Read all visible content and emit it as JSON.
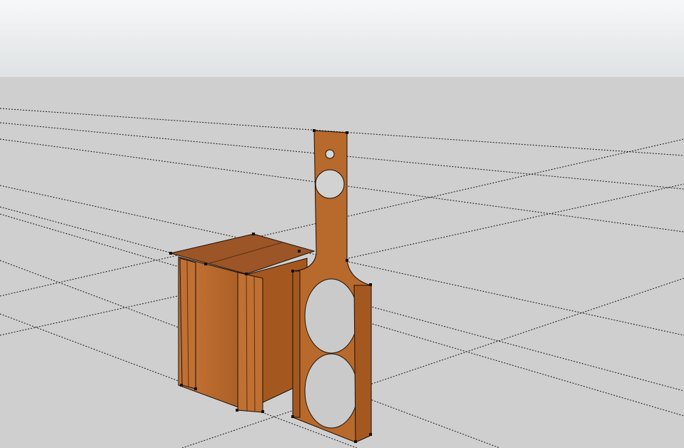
{
  "scene": {
    "sky_top_color": "#f6f8f9",
    "sky_bottom_color": "#dfe2e4",
    "ground_color": "#cfcfcf",
    "guide_line_color": "#1a1a1a",
    "wood_front_color": "#b8692c",
    "wood_side_color": "#a45820",
    "wood_top_color": "#9c5526",
    "edge_color": "#1b1008"
  }
}
